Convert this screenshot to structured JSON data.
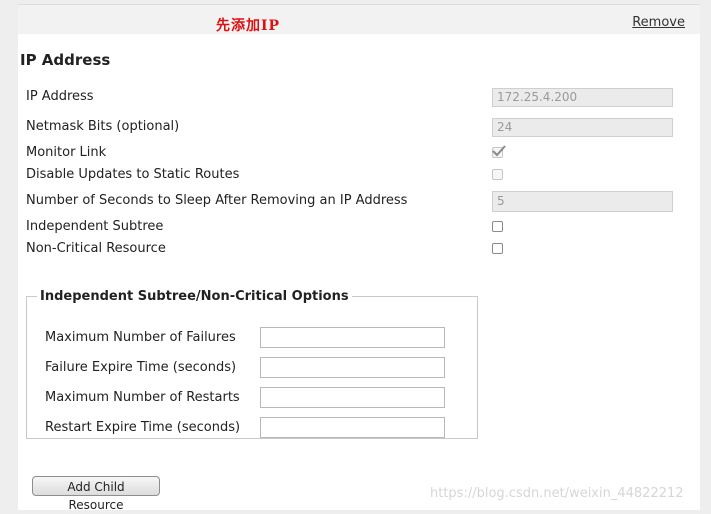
{
  "header": {
    "note": "先添加IP",
    "remove_label": "Remove"
  },
  "section": {
    "title": "IP Address"
  },
  "fields": {
    "ip_address": {
      "label": "IP Address",
      "value": "172.25.4.200"
    },
    "netmask": {
      "label": "Netmask Bits (optional)",
      "value": "24"
    },
    "monitor_link": {
      "label": "Monitor Link",
      "checked": true,
      "disabled": true
    },
    "disable_updates": {
      "label": "Disable Updates to Static Routes",
      "checked": false,
      "disabled": true
    },
    "sleep_seconds": {
      "label": "Number of Seconds to Sleep After Removing an IP Address",
      "value": "5"
    },
    "independent_subtree": {
      "label": "Independent Subtree",
      "checked": false
    },
    "non_critical": {
      "label": "Non-Critical Resource",
      "checked": false
    }
  },
  "options": {
    "legend": "Independent Subtree/Non-Critical Options",
    "max_failures": {
      "label": "Maximum Number of Failures",
      "value": ""
    },
    "failure_expire": {
      "label": "Failure Expire Time (seconds)",
      "value": ""
    },
    "max_restarts": {
      "label": "Maximum Number of Restarts",
      "value": ""
    },
    "restart_expire": {
      "label": "Restart Expire Time (seconds)",
      "value": ""
    }
  },
  "actions": {
    "add_child_label": "Add Child Resource"
  },
  "watermark": "https://blog.csdn.net/weixin_44822212",
  "colors": {
    "note": "#dd1111",
    "panel_bg": "#ffffff",
    "page_bg": "#eeeeee",
    "disabled_input_bg": "#ebebeb"
  },
  "icons": {
    "monitor_link_check": "checkmark-icon"
  }
}
